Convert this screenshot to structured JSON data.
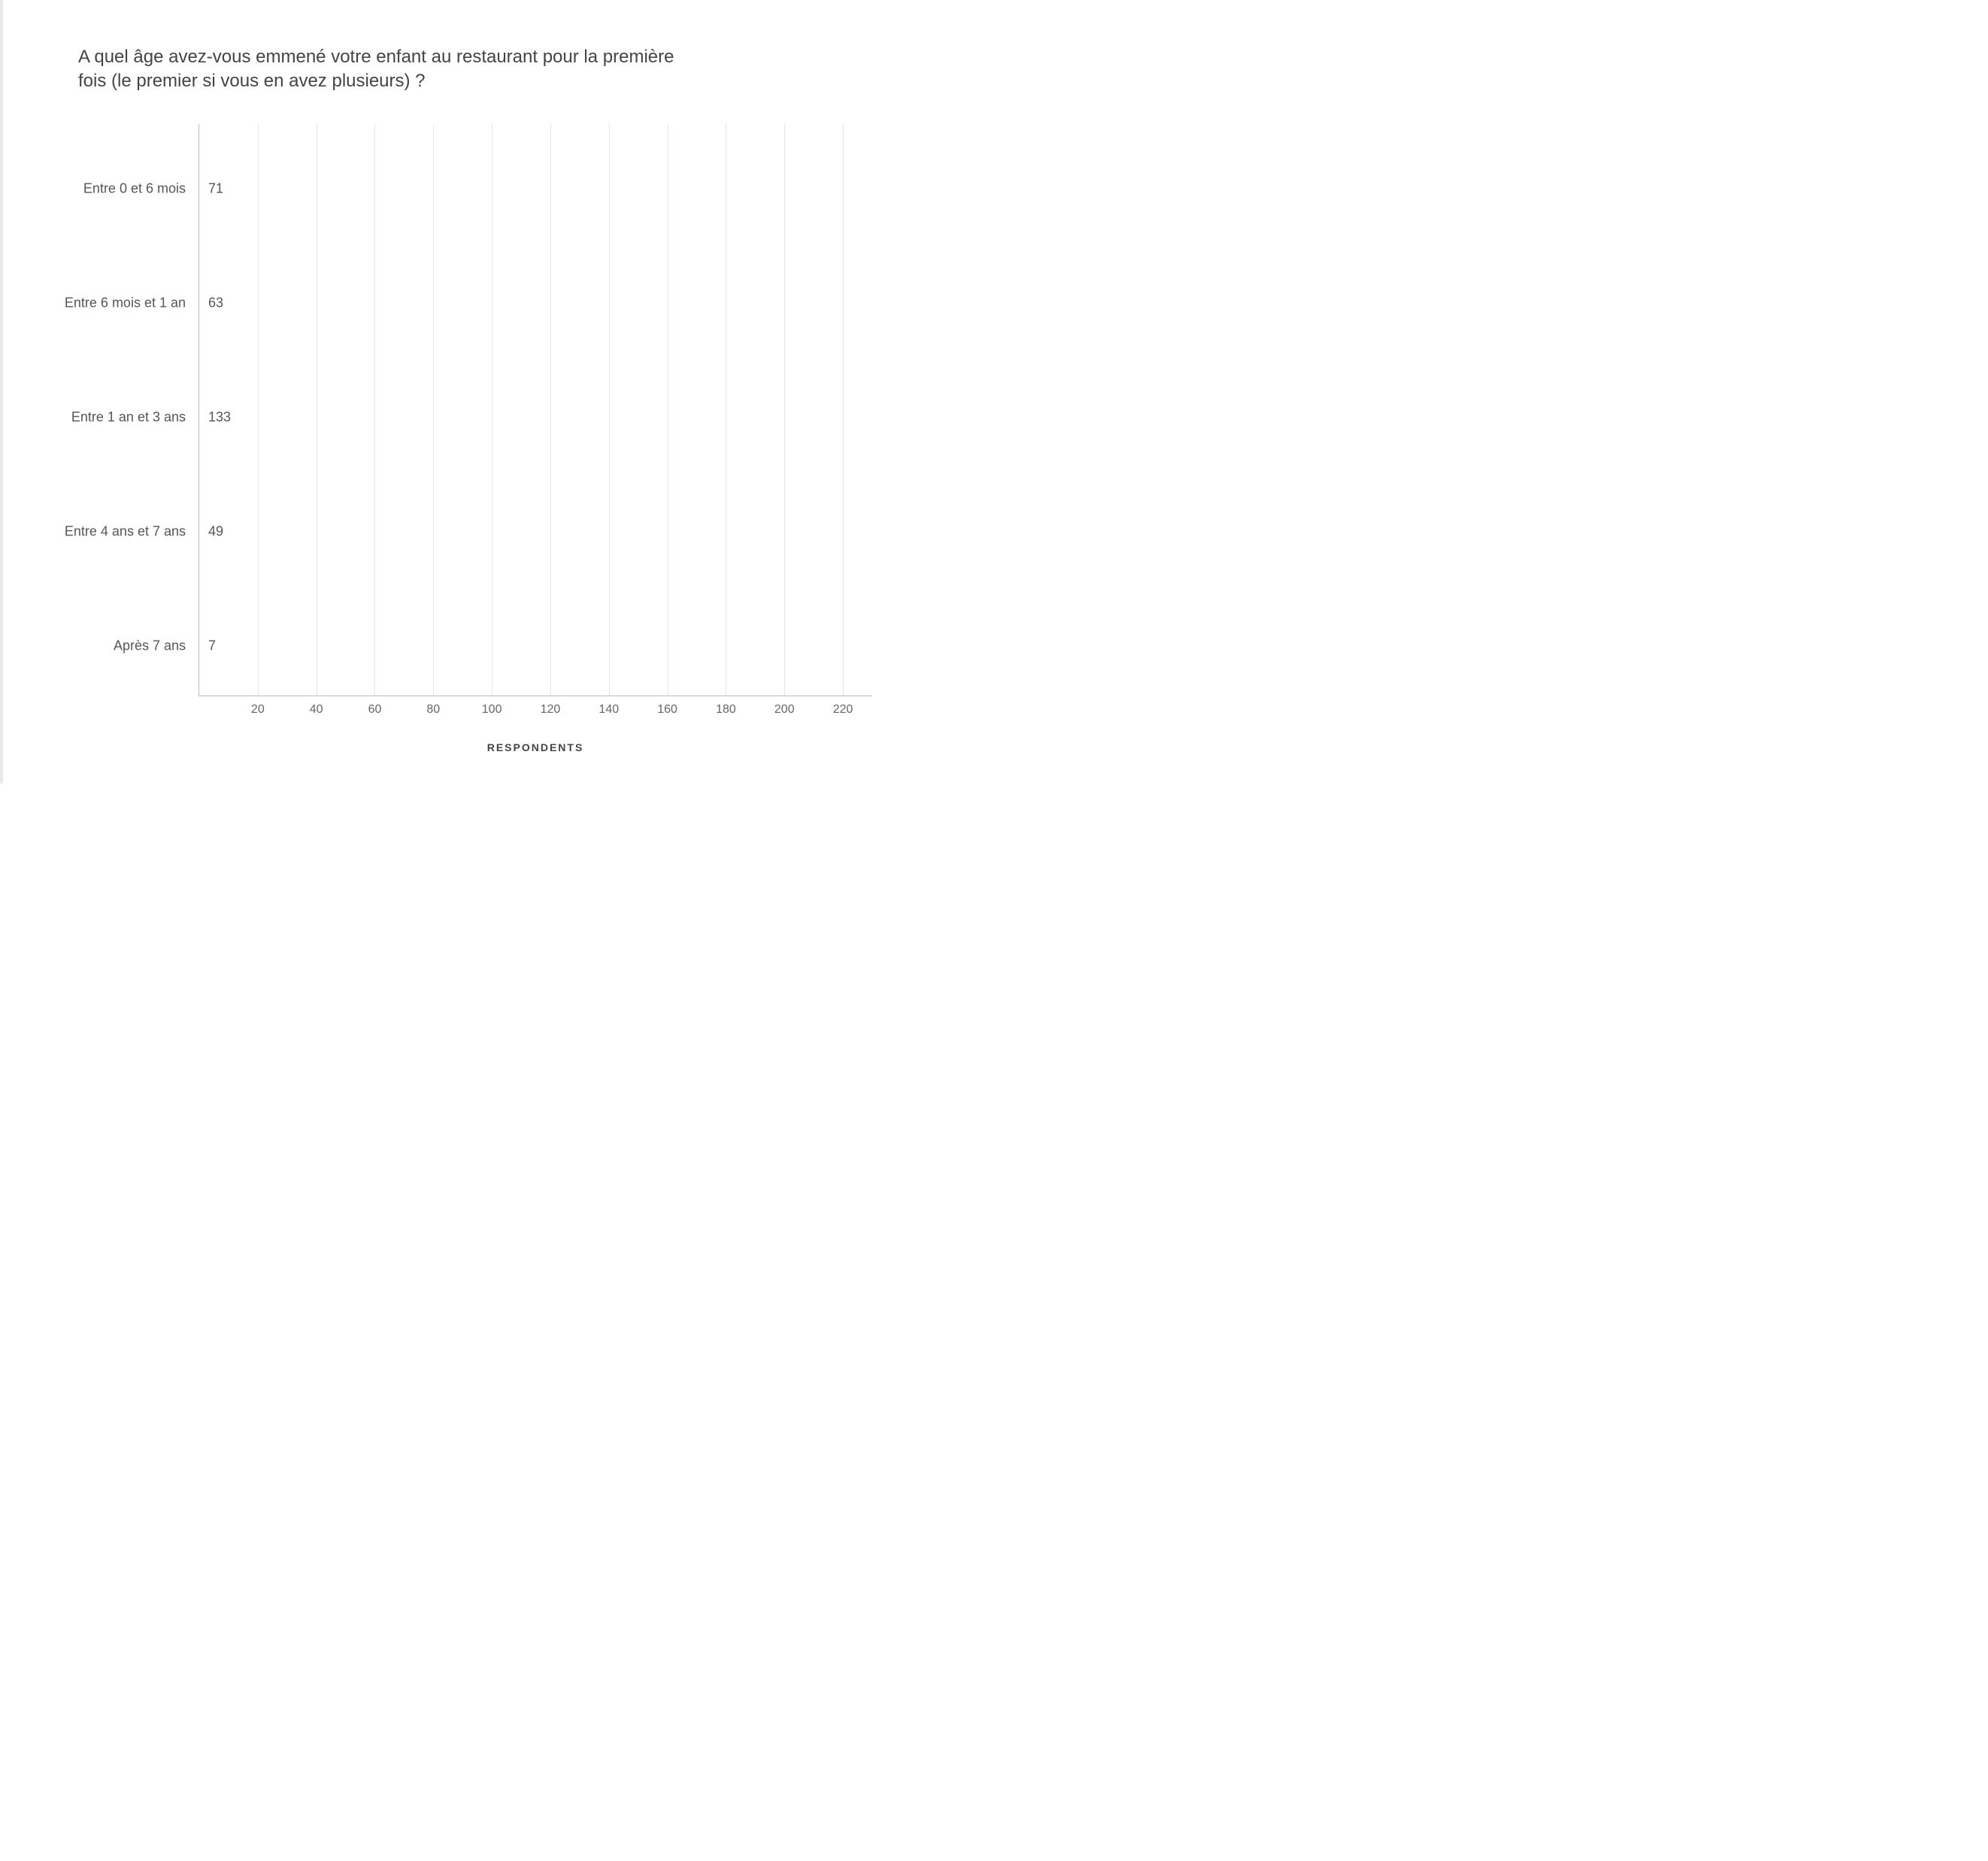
{
  "chart_data": {
    "type": "bar",
    "orientation": "horizontal",
    "title": "A quel âge avez-vous emmené votre enfant au restaurant pour la première fois (le premier si vous en avez plusieurs) ?",
    "xlabel": "RESPONDENTS",
    "ylabel": "",
    "xlim": [
      0,
      230
    ],
    "x_ticks": [
      20,
      40,
      60,
      80,
      100,
      120,
      140,
      160,
      180,
      200,
      220
    ],
    "categories": [
      "Entre 0 et 6 mois",
      "Entre 6 mois et 1 an",
      "Entre 1 an et 3 ans",
      "Entre 4 ans et 7 ans",
      "Après 7 ans"
    ],
    "values": [
      71,
      63,
      133,
      49,
      7
    ],
    "colors": [
      "#29ABE2",
      "#1F6B9E",
      "#F28C28",
      "#3B7E99",
      "#102A43"
    ]
  }
}
